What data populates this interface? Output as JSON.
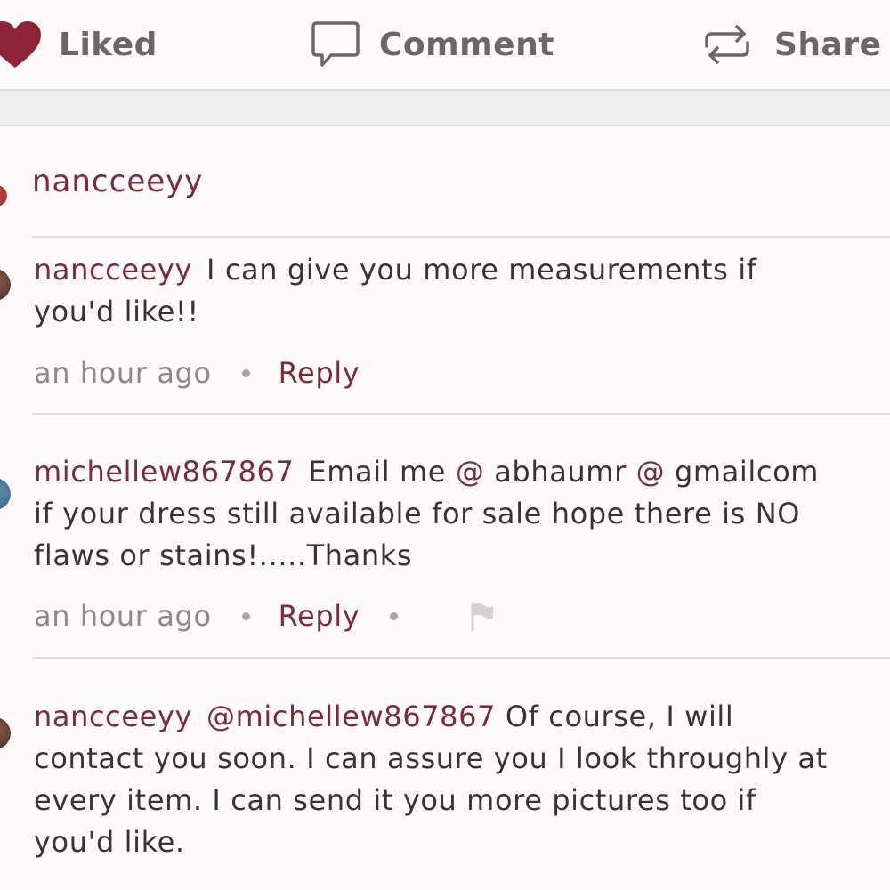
{
  "actions": {
    "liked_label": "Liked",
    "comment_label": "Comment",
    "share_label": "Share"
  },
  "colors": {
    "accent": "#7d2a3a",
    "heart": "#8d2438",
    "muted_text": "#8e898c",
    "background": "#fcfafb"
  },
  "owner": {
    "username": "nancceeyy"
  },
  "comments": [
    {
      "username": "nancceeyy",
      "lines": [
        "I can give you more measurements if",
        "you'd like!!"
      ],
      "time": "an hour ago",
      "reply_label": "Reply"
    },
    {
      "username": "michellew867867",
      "line1_pre": "Email me",
      "at1": "@",
      "line1_mid": "abhaumr",
      "at2": "@",
      "line1_post": "gmailcom",
      "lines_rest": [
        "if your dress still available for sale hope there is NO",
        "flaws or stains!.....Thanks"
      ],
      "time": "an hour ago",
      "reply_label": "Reply"
    },
    {
      "username": "nancceeyy",
      "mention": "@michellew867867",
      "line1_post": "Of course, I will",
      "lines_rest": [
        "contact you soon. I can assure you I look throughly at",
        "every item. I can send it you more pictures too if",
        "you'd like."
      ]
    }
  ],
  "icons": [
    "heart-icon",
    "comment-bubble-icon",
    "share-repost-icon",
    "flag-icon"
  ]
}
